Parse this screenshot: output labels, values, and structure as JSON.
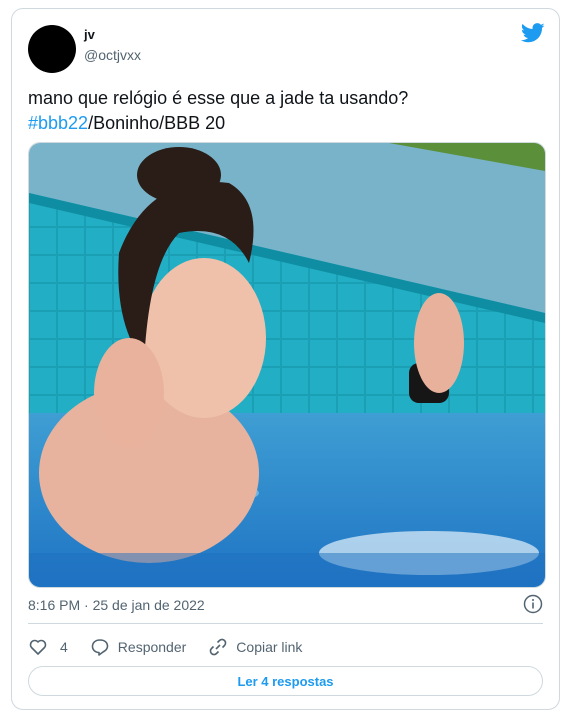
{
  "author": {
    "name": "jv",
    "handle": "@octjvxx"
  },
  "tweet": {
    "text_line1": "mano que relógio é esse que a jade ta usando?",
    "hashtag": "#bbb22",
    "text_line2_rest": "/Boninho/BBB 20"
  },
  "timestamp": "8:16 PM · 25 de jan de 2022",
  "actions": {
    "likes": "4",
    "reply_label": "Responder",
    "copy_link_label": "Copiar link"
  },
  "replies_button": "Ler 4 respostas",
  "colors": {
    "brand": "#1d9bf0",
    "muted": "#536471",
    "border": "#cfd9de"
  },
  "icons": [
    "twitter-bird-icon",
    "info-icon",
    "heart-icon",
    "reply-bubble-icon",
    "link-icon"
  ]
}
